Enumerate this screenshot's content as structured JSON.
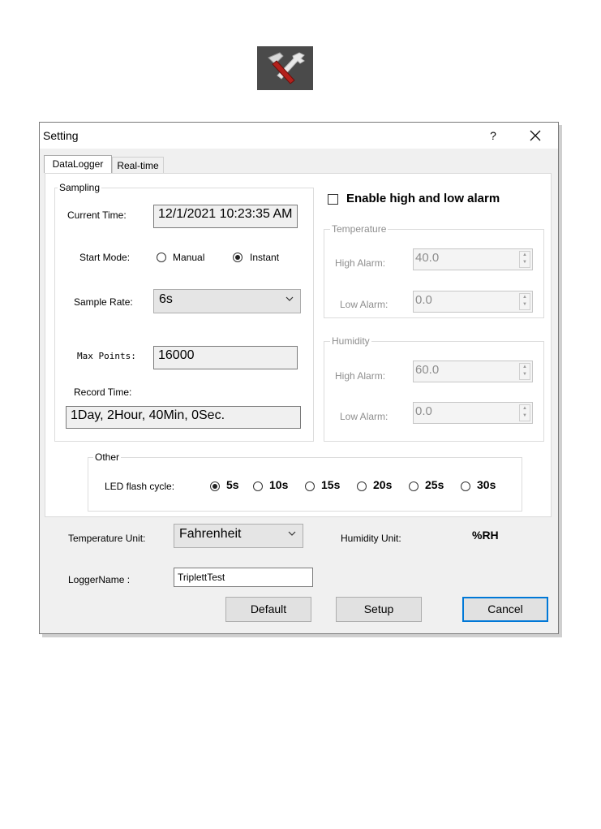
{
  "dialog": {
    "title": "Setting",
    "help": "?",
    "close": "✕"
  },
  "tabs": [
    "DataLogger",
    "Real-time"
  ],
  "sampling": {
    "title": "Sampling",
    "current_time_label": "Current Time:",
    "current_time_value": "12/1/2021 10:23:35 AM",
    "start_mode_label": "Start Mode:",
    "start_mode_options": [
      "Manual",
      "Instant"
    ],
    "start_mode_selected": "Instant",
    "sample_rate_label": "Sample Rate:",
    "sample_rate_value": "6s",
    "max_points_label": "Max Points:",
    "max_points_value": "16000",
    "record_time_label": "Record Time:",
    "record_time_value": "1Day, 2Hour, 40Min, 0Sec."
  },
  "alarm": {
    "enable_label": "Enable high and low alarm",
    "enabled": false,
    "temperature": {
      "title": "Temperature",
      "high_label": "High Alarm:",
      "high_value": "40.0",
      "low_label": "Low Alarm:",
      "low_value": "0.0"
    },
    "humidity": {
      "title": "Humidity",
      "high_label": "High Alarm:",
      "high_value": "60.0",
      "low_label": "Low Alarm:",
      "low_value": "0.0"
    }
  },
  "other": {
    "title": "Other",
    "led_label": "LED flash cycle:",
    "options": [
      "5s",
      "10s",
      "15s",
      "20s",
      "25s",
      "30s"
    ],
    "selected": "5s"
  },
  "units": {
    "temperature_label": "Temperature Unit:",
    "temperature_value": "Fahrenheit",
    "humidity_label": "Humidity Unit:",
    "humidity_value": "%RH"
  },
  "logger": {
    "name_label": "LoggerName :",
    "name_value": "TriplettTest"
  },
  "buttons": {
    "default": "Default",
    "setup": "Setup",
    "cancel": "Cancel"
  }
}
